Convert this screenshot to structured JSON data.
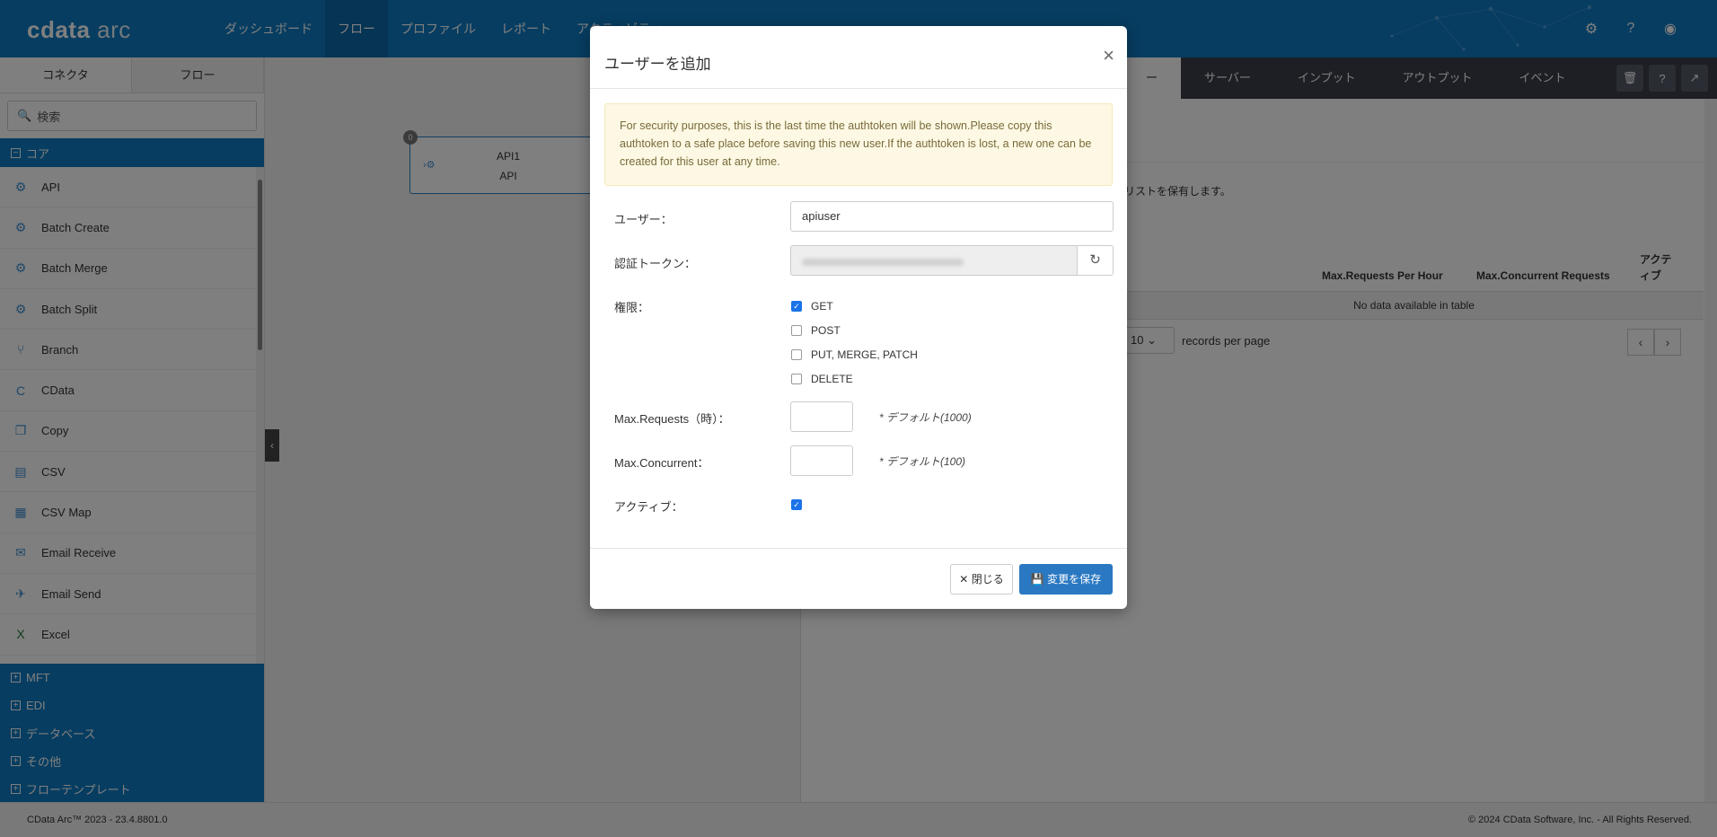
{
  "app": {
    "logo_bold": "cdata",
    "logo_light": "arc"
  },
  "nav": {
    "items": [
      "ダッシュボード",
      "フロー",
      "プロファイル",
      "レポート",
      "アクティビティ"
    ],
    "active_index": 1
  },
  "left": {
    "tabs": [
      "コネクタ",
      "フロー"
    ],
    "search_placeholder": "検索",
    "core_label": "コア",
    "items": [
      {
        "label": "API",
        "icon": "api-icon"
      },
      {
        "label": "Batch Create",
        "icon": "batch-create-icon"
      },
      {
        "label": "Batch Merge",
        "icon": "batch-merge-icon"
      },
      {
        "label": "Batch Split",
        "icon": "batch-split-icon"
      },
      {
        "label": "Branch",
        "icon": "branch-icon"
      },
      {
        "label": "CData",
        "icon": "cdata-icon"
      },
      {
        "label": "Copy",
        "icon": "copy-icon"
      },
      {
        "label": "CSV",
        "icon": "csv-icon"
      },
      {
        "label": "CSV Map",
        "icon": "csv-map-icon"
      },
      {
        "label": "Email Receive",
        "icon": "email-receive-icon"
      },
      {
        "label": "Email Send",
        "icon": "email-send-icon"
      },
      {
        "label": "Excel",
        "icon": "excel-icon"
      }
    ],
    "categories": [
      "MFT",
      "EDI",
      "データベース",
      "その他",
      "フローテンプレート"
    ]
  },
  "canvas": {
    "node_title": "API1",
    "node_subtitle": "API",
    "node_badge": "0"
  },
  "right": {
    "tabs": [
      "ー",
      "サーバー",
      "インプット",
      "アウトプット",
      "イベント"
    ],
    "description": "リストを保有します。",
    "columns": [
      "Max.Requests Per Hour",
      "Max.Concurrent Requests",
      "アクティブ"
    ],
    "empty_text": "No data available in table",
    "page_size": "10",
    "records_label": "records per page"
  },
  "footer": {
    "left": "CData Arc™ 2023 - 23.4.8801.0",
    "right": "© 2024 CData Software, Inc. - All Rights Reserved."
  },
  "modal": {
    "title": "ユーザーを追加",
    "alert": "For security purposes, this is the last time the authtoken will be shown.Please copy this authtoken to a safe place before saving this new user.If the authtoken is lost, a new one can be created for this user at any time.",
    "user_label": "ユーザー：",
    "user_value": "apiuser",
    "token_label": "認証トークン：",
    "perm_label": "権限：",
    "permissions": [
      {
        "label": "GET",
        "checked": true
      },
      {
        "label": "POST",
        "checked": false
      },
      {
        "label": "PUT, MERGE, PATCH",
        "checked": false
      },
      {
        "label": "DELETE",
        "checked": false
      }
    ],
    "max_requests_label": "Max.Requests（時）：",
    "max_requests_hint": "* デフォルト(1000)",
    "max_concurrent_label": "Max.Concurrent：",
    "max_concurrent_hint": "* デフォルト(100)",
    "active_label": "アクティブ：",
    "active_checked": true,
    "close_label": "閉じる",
    "save_label": "変更を保存"
  }
}
